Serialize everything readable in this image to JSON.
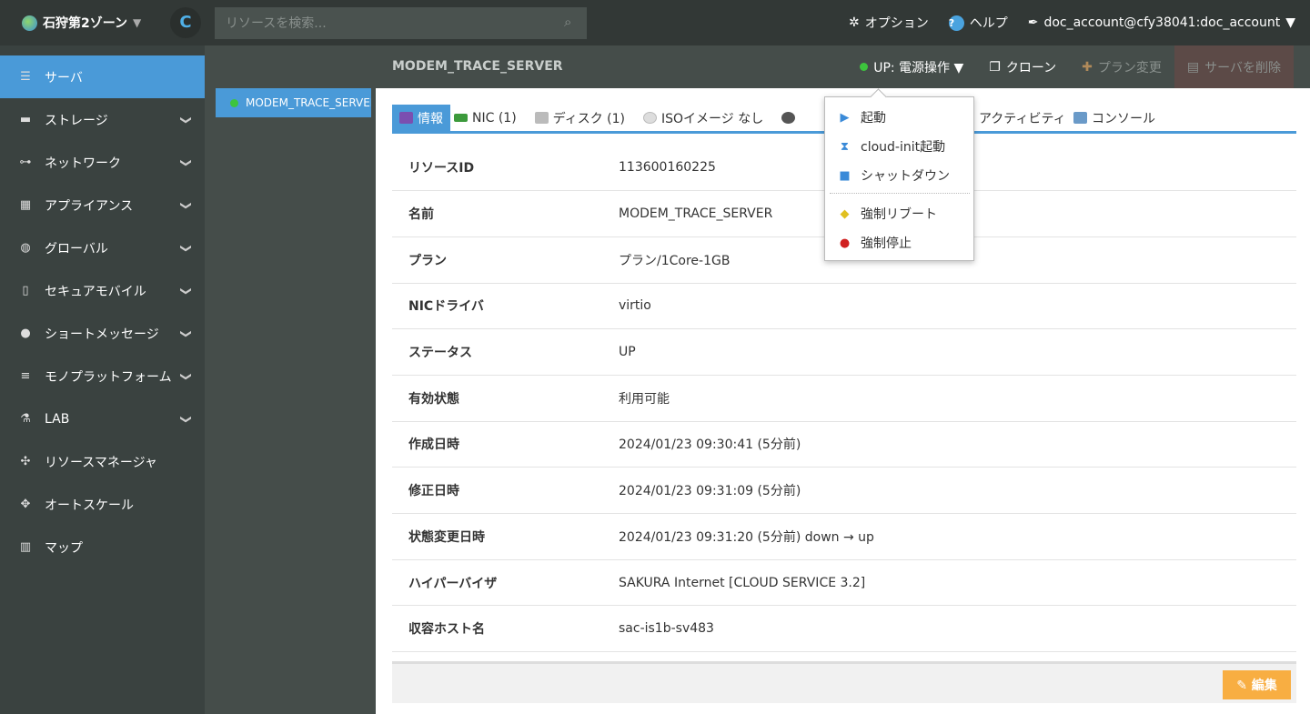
{
  "topbar": {
    "zone": "石狩第2ゾーン",
    "search_placeholder": "リソースを検索...",
    "options": "オプション",
    "help": "ヘルプ",
    "account": "doc_account@cfy38041:doc_account"
  },
  "sidebar": {
    "items": [
      {
        "label": "サーバ",
        "icon": "server-icon",
        "active": true,
        "expandable": false
      },
      {
        "label": "ストレージ",
        "icon": "storage-icon",
        "expandable": true
      },
      {
        "label": "ネットワーク",
        "icon": "network-icon",
        "expandable": true
      },
      {
        "label": "アプライアンス",
        "icon": "appliance-icon",
        "expandable": true
      },
      {
        "label": "グローバル",
        "icon": "globe-icon",
        "expandable": true
      },
      {
        "label": "セキュアモバイル",
        "icon": "mobile-icon",
        "expandable": true
      },
      {
        "label": "ショートメッセージ",
        "icon": "chat-icon",
        "expandable": true
      },
      {
        "label": "モノプラットフォーム",
        "icon": "list-icon",
        "expandable": true
      },
      {
        "label": "LAB",
        "icon": "flask-icon",
        "expandable": true
      },
      {
        "label": "リソースマネージャ",
        "icon": "puzzle-icon",
        "expandable": false
      },
      {
        "label": "オートスケール",
        "icon": "move-icon",
        "expandable": false
      },
      {
        "label": "マップ",
        "icon": "map-icon",
        "expandable": false
      }
    ]
  },
  "server_list": {
    "items": [
      {
        "name": "MODEM_TRACE_SERVER",
        "status_color": "#3dc43d"
      }
    ]
  },
  "header": {
    "title": "MODEM_TRACE_SERVER",
    "power": "UP: 電源操作 ▼",
    "clone": "クローン",
    "plan_change": "プラン変更",
    "delete": "サーバを削除"
  },
  "tabs": [
    {
      "label": "情報",
      "active": true
    },
    {
      "label": "NIC (1)"
    },
    {
      "label": "ディスク (1)"
    },
    {
      "label": "ISOイメージ なし"
    },
    {
      "label": ""
    },
    {
      "label": "アクティビティ"
    },
    {
      "label": "コンソール"
    }
  ],
  "details": [
    {
      "key": "リソースID",
      "value": "113600160225"
    },
    {
      "key": "名前",
      "value": "MODEM_TRACE_SERVER"
    },
    {
      "key": "プラン",
      "value": "プラン/1Core-1GB"
    },
    {
      "key": "NICドライバ",
      "value": "virtio"
    },
    {
      "key": "ステータス",
      "value": "UP"
    },
    {
      "key": "有効状態",
      "value": "利用可能"
    },
    {
      "key": "作成日時",
      "value": "2024/01/23 09:30:41 (5分前)"
    },
    {
      "key": "修正日時",
      "value": "2024/01/23 09:31:09 (5分前)"
    },
    {
      "key": "状態変更日時",
      "value": "2024/01/23 09:31:20 (5分前) down → up"
    },
    {
      "key": "ハイパーバイザ",
      "value": "SAKURA Internet [CLOUD SERVICE 3.2]"
    },
    {
      "key": "収容ホスト名",
      "value": "sac-is1b-sv483"
    }
  ],
  "footer": {
    "edit": "編集"
  },
  "power_menu": {
    "items": [
      {
        "label": "起動"
      },
      {
        "label": "cloud-init起動"
      },
      {
        "label": "シャットダウン"
      },
      {
        "label": "強制リブート"
      },
      {
        "label": "強制停止"
      }
    ]
  },
  "colors": {
    "accent": "#4a9ad8",
    "edit_button": "#f8ae42",
    "status_up": "#3dc43d"
  }
}
